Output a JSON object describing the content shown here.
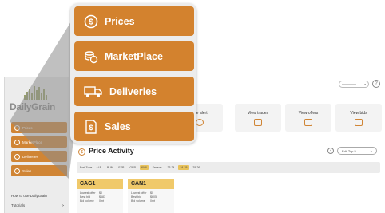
{
  "app": {
    "brand": "DailyGrain",
    "sidebar": {
      "items": [
        {
          "label": "Prices",
          "icon": "dollar-circle-icon"
        },
        {
          "label": "MarketPlace",
          "icon": "coins-stack-icon"
        },
        {
          "label": "Deliveries",
          "icon": "truck-icon"
        },
        {
          "label": "Sales",
          "icon": "dollar-document-icon"
        }
      ],
      "help_link": "How to use DailyGrain",
      "tutorials_link": "Tutorials",
      "tutorials_chevron": ">"
    },
    "header": {
      "help_label": "?",
      "select_chevron": "▾"
    },
    "quick_actions": [
      {
        "label": "rice alert",
        "icon": "bell-icon"
      },
      {
        "label": "View trades",
        "icon": "handshake-icon"
      },
      {
        "label": "View offers",
        "icon": "offers-icon"
      },
      {
        "label": "View bids",
        "icon": "bid-hand-icon"
      }
    ],
    "price_activity": {
      "title": "Price Activity",
      "icon_label": "$",
      "nav_prev": "‹",
      "edit_label": "Edit Top 5",
      "edit_chevron": ">",
      "filter": {
        "label": "Port Zone",
        "chips": [
          "ALB",
          "BUN",
          "ESP",
          "GER",
          "KWI",
          "Season",
          "23-24",
          "24-25",
          "25-26"
        ],
        "active_chips": [
          "KWI",
          "24-25"
        ]
      },
      "price_cards": [
        {
          "code": "CAG1",
          "rows": [
            [
              "Lowest offer",
              "$0"
            ],
            [
              "Best bid",
              "$683"
            ],
            [
              "Bid volume",
              "0mt"
            ]
          ]
        },
        {
          "code": "CAN1",
          "rows": [
            [
              "Lowest offer",
              "$0"
            ],
            [
              "Best bid",
              "$605"
            ],
            [
              "Bid volume",
              "0mt"
            ]
          ]
        }
      ]
    }
  },
  "overlay_menu": {
    "items": [
      {
        "label": "Prices",
        "icon": "dollar-circle-icon"
      },
      {
        "label": "MarketPlace",
        "icon": "coins-stack-icon"
      },
      {
        "label": "Deliveries",
        "icon": "truck-icon"
      },
      {
        "label": "Sales",
        "icon": "dollar-document-icon"
      }
    ]
  },
  "colors": {
    "accent": "#d3822e",
    "card_header": "#f0c96a",
    "chip_active": "#e8c25a",
    "panel": "#ececec"
  }
}
